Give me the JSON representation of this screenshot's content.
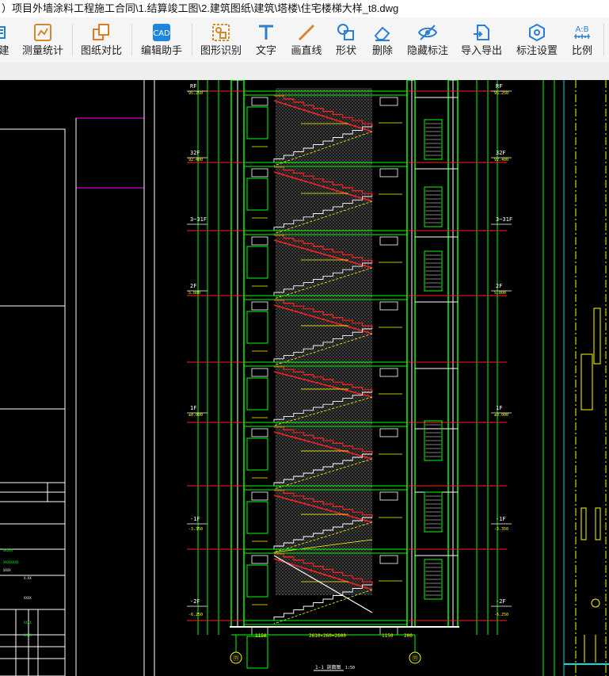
{
  "window": {
    "title": "）项目外墙涂料工程施工合同\\1.结算竣工图\\2.建筑图纸\\建筑\\塔楼\\住宅楼梯大样_t8.dwg"
  },
  "toolbar": {
    "items": [
      {
        "label": "建",
        "icon": "build-icon"
      },
      {
        "label": "测量统计",
        "icon": "measure-stats-icon"
      },
      {
        "label": "图纸对比",
        "icon": "compare-drawings-icon"
      },
      {
        "label": "编辑助手",
        "icon": "edit-assistant-icon"
      },
      {
        "label": "图形识别",
        "icon": "shape-recognition-icon"
      },
      {
        "label": "文字",
        "icon": "text-icon"
      },
      {
        "label": "画直线",
        "icon": "line-icon"
      },
      {
        "label": "形状",
        "icon": "shape-icon"
      },
      {
        "label": "删除",
        "icon": "eraser-icon"
      },
      {
        "label": "隐藏标注",
        "icon": "hide-annotation-icon"
      },
      {
        "label": "导入导出",
        "icon": "import-export-icon"
      },
      {
        "label": "标注设置",
        "icon": "annotation-settings-icon"
      },
      {
        "label": "比例",
        "icon": "scale-icon"
      }
    ],
    "scale_icon_text": "A:B"
  },
  "drawing": {
    "section_label": "1-1 剖面图",
    "section_scale": "1:50",
    "axis_marks": [
      "⑪",
      "⑪"
    ],
    "floor_labels": [
      "RF",
      "32F",
      "3~31F",
      "2F",
      "1F",
      "-1F",
      "-2F"
    ],
    "elevations": [
      "95.250",
      "92.400",
      "5.800",
      "±0.000",
      "-3.350",
      "-6.250"
    ],
    "bottom_dims": [
      "1150",
      "2610×260=2600",
      "1150",
      "200"
    ],
    "colors": {
      "wall": "#00ff00",
      "stair": "#ff2020",
      "dim": "#ffff00",
      "hatch": "#d0d0d0",
      "frame": "#ffffff",
      "accent": "#ff00ff",
      "cyan": "#00e0e0"
    }
  }
}
